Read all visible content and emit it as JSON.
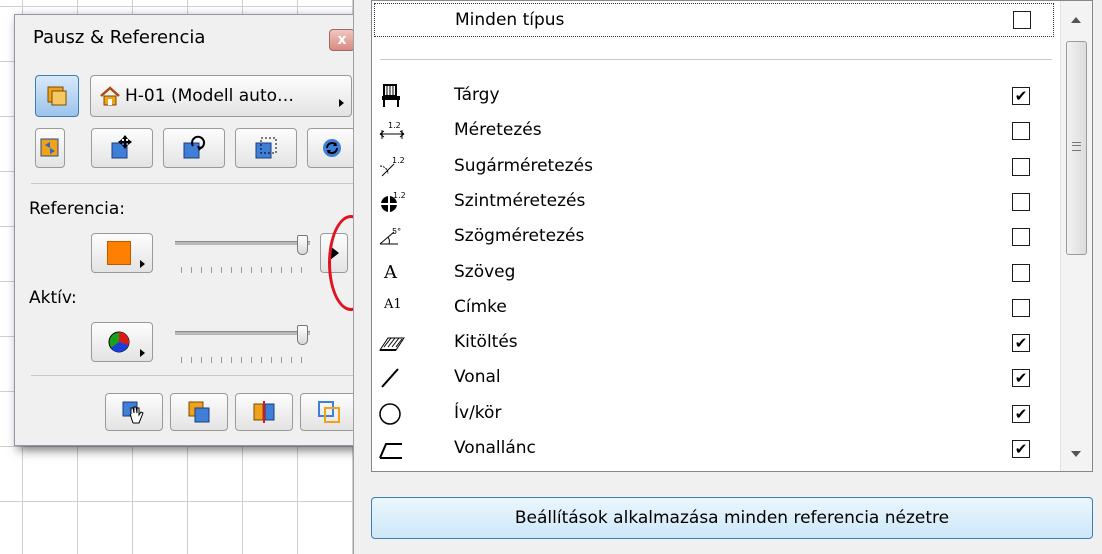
{
  "palette": {
    "title": "Pausz & Referencia",
    "close_glyph": "x",
    "reference_dropdown": "H-01 (Modell auto…",
    "reference_label": "Referencia:",
    "active_label": "Aktív:",
    "reference_slider_level": 0.95,
    "active_slider_level": 0.95
  },
  "colors": {
    "orange_swatch": "#ff7f00",
    "highlight_red": "#e0141e",
    "selected_blue": "#2b66c9",
    "apply_button": "#cde8f8"
  },
  "list": {
    "all_types": {
      "label": "Minden típus",
      "checked": false
    },
    "items": [
      {
        "label": "Tárgy",
        "checked": true,
        "icon": "chair-icon"
      },
      {
        "label": "Méretezés",
        "checked": false,
        "icon": "dimension-icon"
      },
      {
        "label": "Sugárméretezés",
        "checked": false,
        "icon": "radial-dimension-icon"
      },
      {
        "label": "Szintméretezés",
        "checked": false,
        "icon": "level-dimension-icon"
      },
      {
        "label": "Szögméretezés",
        "checked": false,
        "icon": "angle-dimension-icon"
      },
      {
        "label": "Szöveg",
        "checked": false,
        "icon": "text-icon",
        "glyph": "A"
      },
      {
        "label": "Címke",
        "checked": false,
        "icon": "label-icon",
        "glyph": "A1"
      },
      {
        "label": "Kitöltés",
        "checked": true,
        "icon": "fill-icon"
      },
      {
        "label": "Vonal",
        "checked": true,
        "icon": "line-icon"
      },
      {
        "label": "Ív/kör",
        "checked": true,
        "icon": "arc-circle-icon"
      },
      {
        "label": "Vonallánc",
        "checked": true,
        "icon": "polyline-icon"
      }
    ]
  },
  "apply_button": {
    "label": "Beállítások alkalmazása minden referencia nézetre"
  },
  "check_glyph": "✔"
}
